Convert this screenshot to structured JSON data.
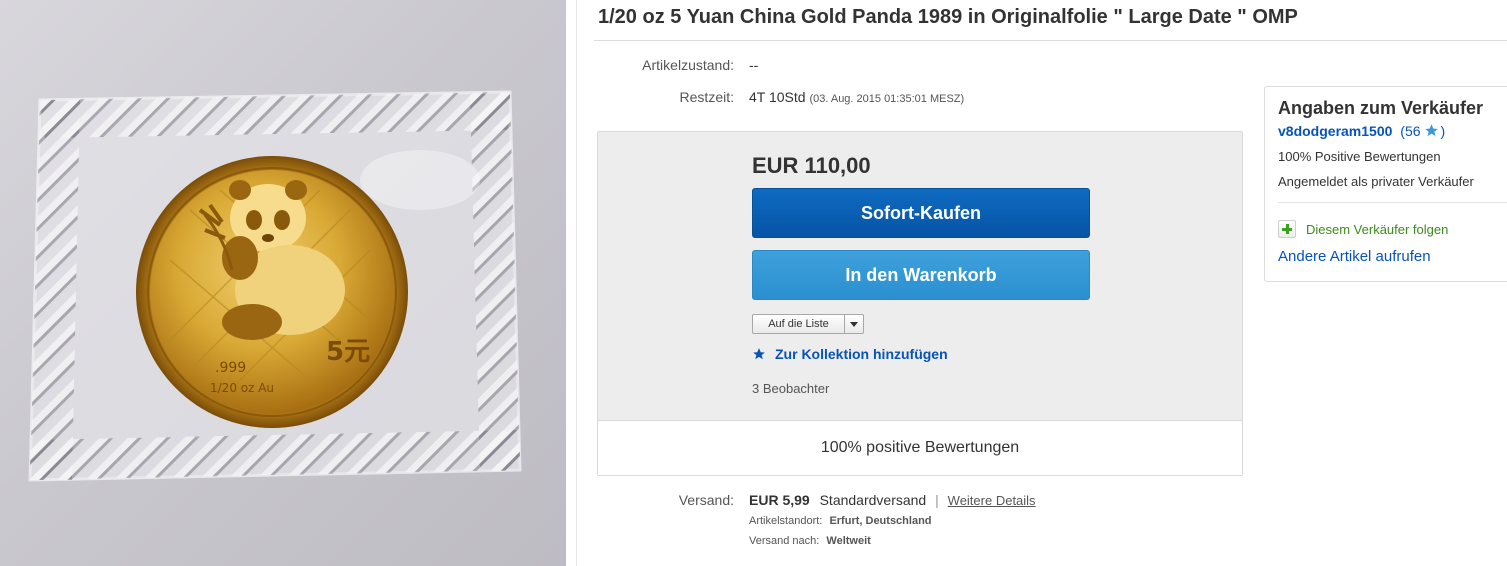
{
  "title": "1/20 oz 5 Yuan China Gold Panda 1989 in Originalfolie \" Large Date \" OMP",
  "condition": {
    "label": "Artikelzustand:",
    "value": "--"
  },
  "remaining": {
    "label": "Restzeit:",
    "value": "4T 10Std",
    "end": "(03. Aug. 2015   01:35:01 MESZ)"
  },
  "buybox": {
    "price": "EUR 110,00",
    "buy_now": "Sofort-Kaufen",
    "add_to_cart": "In den Warenkorb",
    "watch_list": "Auf die Liste",
    "collection": "Zur Kollektion hinzufügen",
    "watchers": "3 Beobachter",
    "footer": "100% positive Bewertungen"
  },
  "shipping": {
    "label": "Versand:",
    "cost": "EUR 5,99",
    "method": "Standardversand",
    "separator": "|",
    "details_link": "Weitere Details",
    "location_label": "Artikelstandort:",
    "location": "Erfurt, Deutschland",
    "ships_to_label": "Versand nach:",
    "ships_to": "Weltweit"
  },
  "seller": {
    "heading": "Angaben zum Verkäufer",
    "name": "v8dodgeram1500",
    "feedback_open": "(56",
    "feedback_close": ")",
    "positive": "100% Positive Bewertungen",
    "type": "Angemeldet als privater Verkäufer",
    "follow": "Diesem Verkäufer folgen",
    "other_items": "Andere Artikel aufrufen"
  },
  "coin": {
    "denomination": "5元",
    "fineness": ".999",
    "weight": "1/20 oz Au"
  },
  "colors": {
    "buy_button": "#0654a5",
    "cart_button": "#2b8fd0",
    "link": "#0654ba",
    "follow_green": "#3c8b1a"
  }
}
